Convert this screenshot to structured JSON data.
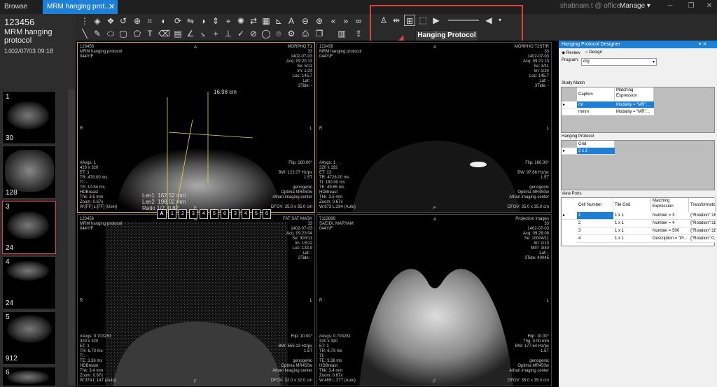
{
  "titlebar": {
    "tab_browse": "Browse Exam",
    "tab_mrm": "MRM hanging prot...",
    "tab_close": "✕",
    "user": "shabnam.t @ office",
    "manage": "Manage",
    "win_min": "─",
    "win_max": "❐",
    "win_close": "✕"
  },
  "patient": {
    "id": "123456",
    "name": "MRM hanging protocol",
    "date": "1402/07/03 09:18"
  },
  "thumbnails": [
    {
      "num": "1",
      "count": "30"
    },
    {
      "num": "",
      "count": "128"
    },
    {
      "num": "3",
      "count": "24"
    },
    {
      "num": "4",
      "count": "24"
    },
    {
      "num": "5",
      "count": "912"
    },
    {
      "num": "6",
      "count": ""
    }
  ],
  "tooltip": "Hanging Protocol",
  "viewports": {
    "vp1": {
      "tl": "123456\nMRM hanging protocol\n044Y/F",
      "tr": "MORPHO T1\n33\n1402-07-03\nAcq: 09:20:13\nSe: 5/11\nIm: 1/24\nLoc: 145.7\nLat: -\n3Tide: -",
      "bl": "#Avgs: 1\n416 x 320\nET: 1\nTR: 478.00 ms\nTI: -\nTE: 10.54 ms\nHDBreast\nThk: 3.5 mm\nZoom: 0.67x\nW:[FF] L:[FF] (User)",
      "br": "Flip: 160.00°\n\nBW: 122.07 Hz/px\n1.5T\n\ngenogenic\nOptima MR450w\nAthari imaging center\n\nDFOV: 35.0 x 35.0 cm",
      "top": "A",
      "left": "R",
      "right": "L",
      "bottom": "F",
      "m1": "16.98 cm",
      "m2": "Len1  162.52 mm\nLen2  198.02 mm\nRatio 1/2  0.82"
    },
    "vp2": {
      "tl": "123456\nMRM hanging protocol\n044Y/F",
      "tr": "MORPHO T2STIR\n33\n1402-07-03\nAcq: 09:21:13\nSe: 3/11\nIm: 1/24\nLoc: 145.7\nLat: -\n3Tide: -",
      "bl": "#Avgs: 1\n320 x 192\nET: 13\nTR: 4728.00 ms\nTI: 180.00 ms\nTE: 49.65 ms\nHDBreast\nThk: 3.5 mm\nZoom: 0.67x\nW:873 L:284 (Auto)",
      "br": "Flip: 160.00°\n\nBW: 97.66 Hz/px\n1.5T\n\ngenogenic\nOptima MR450w\nAthari imaging center\n\nDFOV: 35.0 x 35.0 cm",
      "top": "A",
      "left": "R",
      "right": "L",
      "bottom": "F"
    },
    "vp3": {
      "tl": "123456\nMRM hanging protocol\n044Y/F",
      "tr": "FAT SAT MASK\n33\n1402-07-03\nAcq: 09:23:04\nSe: 300/11\nIm: 1/512\nLoc: 133.9\nLat: -\n3Tide: -",
      "bl": "#Avgs: 0.703281\n320 x 320\nET: 1\nTR: 6.73 ms\nTI: -\nTE: 3.36 ms\nHDBreast\nThk: 3.4 mm\nZoom: 0.67x\nW:374 L:147 (Auto)",
      "br": "Flip: 10.00°\n\nBW: 555.13 Hz/px\n1.5T\n\ngenogenic\nOptima MR450w\nAthari imaging center\n\nDFOV: 32.0 x 32.0 cm",
      "top": "A",
      "left": "R",
      "right": "L",
      "bottom": "F",
      "nav": [
        "A",
        "1",
        "2",
        "3",
        "4",
        "5",
        "6",
        "3",
        "4",
        "5",
        "6"
      ]
    },
    "vp4": {
      "tl": "7113889\nSAEIDI, MARYAM\n044Y/F",
      "tr": "Projection images\n33\n1402-07-03\nAcq: 09:28:08\nSe: 10004/11\nIm: 1/13\nMIP: 3/40\nLat: -\n3Tide: 40045",
      "bl": "#Avgs: 0.703281\n320 x 320\nET: 1\nTR: 6.73 ms\nTI: -\nTE: 3.36 ms\nHDBreast\nThk: 3.4 mm\nZoom: 0.67x\nW:469 L:277 (Auto)",
      "br": "Flip: 10.00°\nThg: 0.00 mm\nBW: 177.54 Hz/px\n1.5T\n\ngenogenic\nOptima MR450w\nAthari imaging center\n\nDFOV: 35.0 x 35.0 cm",
      "top": "A",
      "left": "R",
      "right": "L",
      "bottom": "F"
    }
  },
  "designer": {
    "title": "Hanging Protocol Designer",
    "pin": "▾ ✕",
    "mode_review": "Review",
    "mode_design": "Design",
    "program_label": "Program:",
    "program_value": "drg",
    "study_match_label": "Study Match",
    "study_headers": [
      "Caption",
      "Matching Expression"
    ],
    "study_rows": [
      {
        "caption": "mr",
        "expr": "Modality = \"MR\"..."
      },
      {
        "caption": "mmm",
        "expr": "Modality = \"MR\"..."
      }
    ],
    "hp_label": "Hanging Protocol",
    "hp_header": "Grid",
    "hp_row": "2 x 2",
    "viewports_label": "View Ports",
    "vp_headers": [
      "Cell Number",
      "Tile Grid",
      "Matching Expression",
      "Transformation"
    ],
    "vp_rows": [
      {
        "cell": "1",
        "tile": "1 x 1",
        "expr": "Number = 3",
        "trans": "{\"Rotation\":18"
      },
      {
        "cell": "2",
        "tile": "1 x 1",
        "expr": "Number = 4",
        "trans": "{\"Rotation\":18"
      },
      {
        "cell": "3",
        "tile": "1 x 1",
        "expr": "Number = 500",
        "trans": "{\"Rotation\":18"
      },
      {
        "cell": "4",
        "tile": "1 x 1",
        "expr": "Description = \"Pr...",
        "trans": "{\"Rotation\":0,"
      }
    ]
  },
  "colors": {
    "accent": "#1e7fd6",
    "highlight": "#e0403e",
    "active_viewport": "#d89a20"
  }
}
